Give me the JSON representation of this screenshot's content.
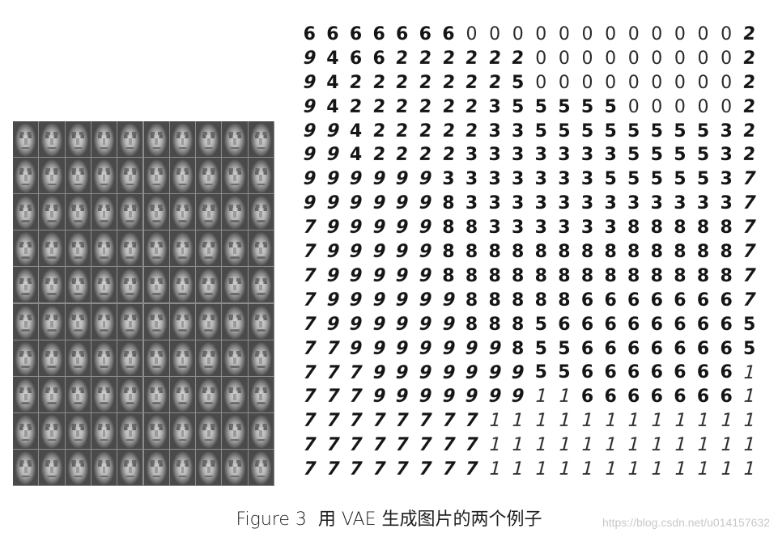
{
  "caption": {
    "label": "Figure 3",
    "text": "用 VAE 生成图片的两个例子"
  },
  "watermark": "https://blog.csdn.net/u014157632",
  "faces_grid": {
    "rows": 10,
    "cols": 10
  },
  "digits_grid": {
    "rows": [
      "66666660000000000002",
      "94662222220000000002",
      "94222222250000000002",
      "94222222355555000002",
      "99422222335555555532",
      "99422223333333555532",
      "99999933333335555537",
      "99999983333333333337",
      "79999988333333888887",
      "79999988888888888887",
      "79999988888888888887",
      "79999998888866666667",
      "79999998885666666665",
      "77999999985566666665",
      "77799999995566666661",
      "77799999991166666661",
      "77777777111111111111",
      "77777777111111111111",
      "77777777111111111111"
    ]
  }
}
